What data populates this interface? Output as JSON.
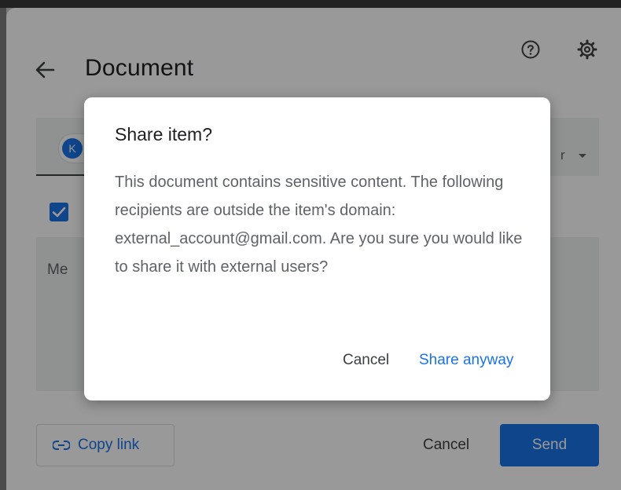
{
  "header": {
    "title": "Document",
    "back_icon": "arrow-back-icon",
    "help_icon": "help-icon",
    "settings_icon": "gear-icon"
  },
  "recipients": {
    "chip_initial": "K",
    "role_label": "r"
  },
  "message": {
    "placeholder_partial": "Me"
  },
  "footer": {
    "copy_link_label": "Copy link",
    "cancel_label": "Cancel",
    "send_label": "Send"
  },
  "dialog": {
    "title": "Share item?",
    "body": "This document contains sensitive content. The following recipients are outside the item's domain: external_account@gmail.com. Are you sure you would like to share it with external users?",
    "cancel_label": "Cancel",
    "share_label": "Share anyway"
  },
  "colors": {
    "accent": "#1a73e8",
    "scrim": "rgba(0,0,0,0.4)"
  }
}
